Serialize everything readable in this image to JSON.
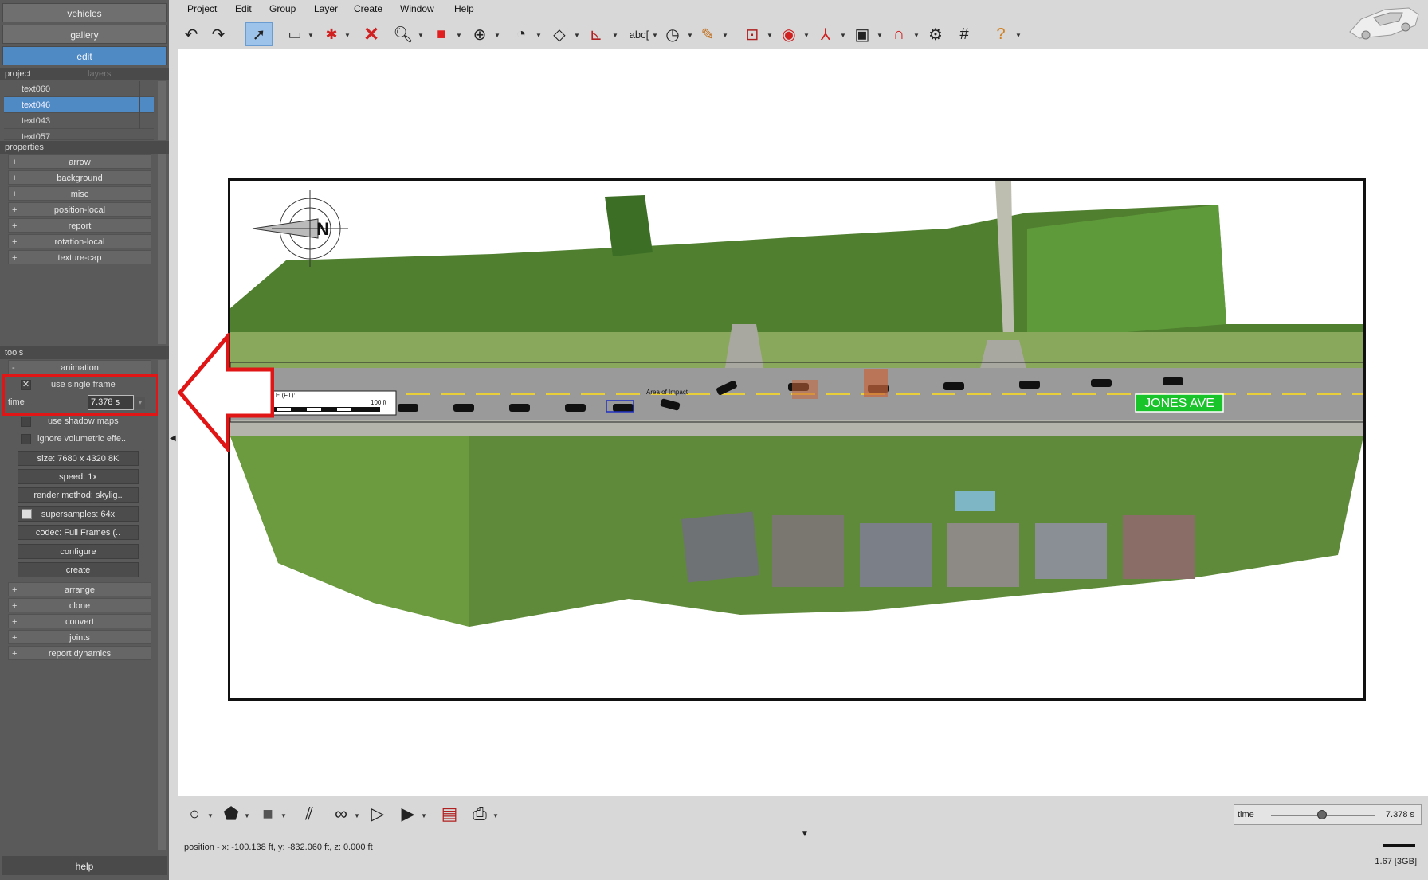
{
  "left_panel": {
    "tabs": [
      {
        "label": "vehicles",
        "active": false
      },
      {
        "label": "gallery",
        "active": false
      },
      {
        "label": "edit",
        "active": true
      }
    ],
    "project_header": "project",
    "layers_header": "layers",
    "project_items": [
      "text060",
      "text046",
      "text043",
      "text057"
    ],
    "selected_project_item": "text046",
    "properties_header": "properties",
    "properties": [
      "arrow",
      "background",
      "misc",
      "position-local",
      "report",
      "rotation-local",
      "texture-cap"
    ],
    "tools_header": "tools",
    "animation": {
      "label": "animation",
      "use_single_frame": {
        "label": "use single frame",
        "checked": true
      },
      "time_label": "time",
      "time_value": "7.378 s",
      "use_shadow_maps": "use shadow maps",
      "ignore_volumetric": "ignore volumetric effe..",
      "size": "size: 7680 x 4320 8K",
      "speed": "speed: 1x",
      "render_method": "render method: skylig..",
      "supersamples": "supersamples: 64x",
      "codec": "codec: Full Frames (..",
      "configure": "configure",
      "create": "create"
    },
    "more_tools": [
      "arrange",
      "clone",
      "convert",
      "joints",
      "report dynamics"
    ],
    "help": "help"
  },
  "menu": [
    "Project",
    "Edit",
    "Group",
    "Layer",
    "Create",
    "Window",
    "Help"
  ],
  "toolbar_icons": [
    "undo-icon",
    "redo-icon",
    "select-arrow-icon",
    "rect-select-icon",
    "delete-vertex-icon",
    "delete-icon",
    "zoom-icon",
    "cube-icon",
    "move-icon",
    "measure-icon",
    "eraser-icon",
    "dimension-icon",
    "text-abc-icon",
    "speed-gauge-icon",
    "pencil-icon",
    "target-point-icon",
    "record-icon",
    "axis-icon",
    "image-icon",
    "magnet-icon",
    "gear-icon",
    "grid-icon",
    "help-icon"
  ],
  "scene": {
    "scale_title": "SCALE (FT):",
    "scale_zero": "0",
    "scale_end": "100 ft",
    "street_sign": "JONES AVE",
    "impact_label": "Area of Impact",
    "colors": {
      "street_sign_bg": "#19c32a",
      "grass": "#5f8a3a",
      "road": "#9a9a9a"
    }
  },
  "bottom": {
    "status": "position - x: -100.138 ft, y: -832.060 ft, z: 0.000 ft",
    "time_label": "time",
    "time_value": "7.378 s",
    "time_fraction": 0.49,
    "memory": "1.67 [3GB]"
  }
}
